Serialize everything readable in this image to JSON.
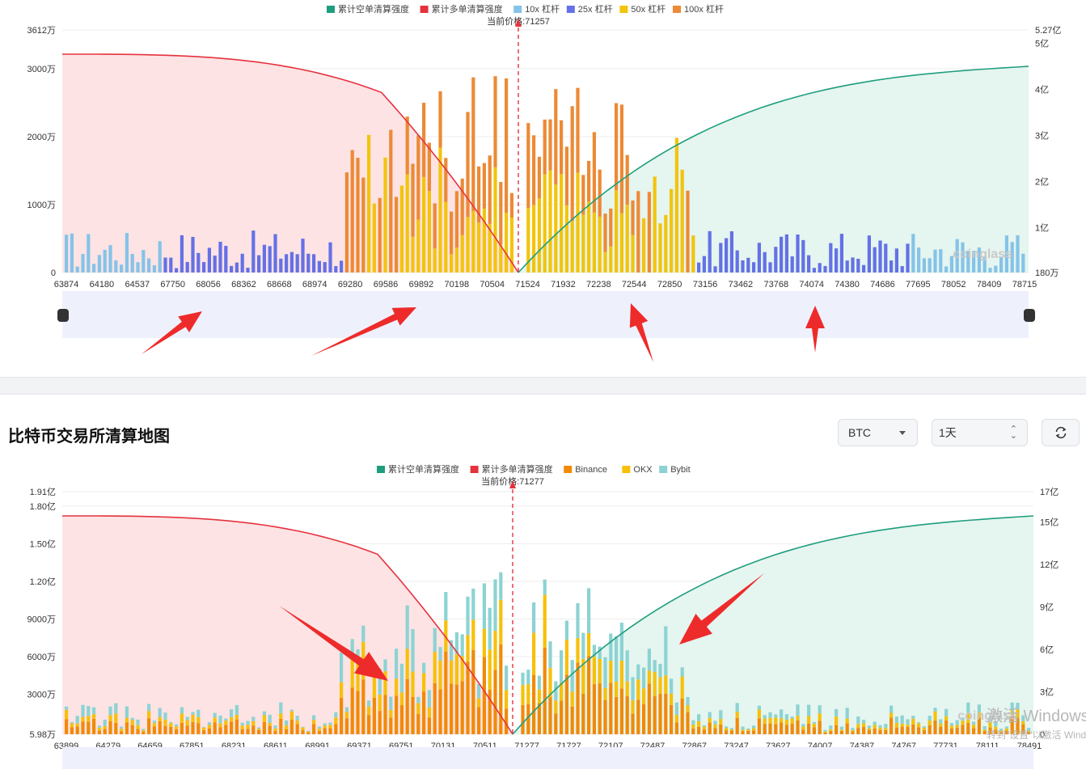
{
  "chart_data": [
    {
      "type": "bar",
      "legend": [
        "累计空单清算强度",
        "累计多单清算强度",
        "10x 杠杆",
        "25x 杠杆",
        "50x 杠杆",
        "100x 杠杆"
      ],
      "current_price_label": "当前价格:71257",
      "y_left_ticks": [
        "3612万",
        "3000万",
        "2000万",
        "1000万",
        "0"
      ],
      "y_right_ticks": [
        "5.27亿",
        "5亿",
        "4亿",
        "3亿",
        "2亿",
        "1亿",
        "180万"
      ],
      "x_ticks": [
        "63874",
        "64180",
        "64537",
        "67750",
        "68056",
        "68362",
        "68668",
        "68974",
        "69280",
        "69586",
        "69892",
        "70198",
        "70504",
        "71524",
        "71932",
        "72238",
        "72544",
        "72850",
        "73156",
        "73462",
        "73768",
        "74074",
        "74380",
        "74686",
        "77695",
        "78052",
        "78409",
        "78715"
      ],
      "ylim_left": [
        0,
        3612
      ],
      "ylim_right": [
        1.8,
        527
      ],
      "left_unit": "万",
      "right_unit": "百万",
      "current_price_index": 112,
      "series": [
        {
          "name": "100x 杠杆",
          "values": [
            0,
            0,
            0,
            0,
            0,
            0,
            0,
            0,
            0,
            0,
            0,
            0,
            0,
            0,
            0,
            0,
            0,
            0,
            0,
            0,
            0,
            0,
            0,
            0,
            0,
            0,
            0,
            0,
            0,
            0,
            0,
            0,
            0,
            0,
            0,
            0,
            0,
            0,
            0,
            0,
            0,
            0,
            0,
            0,
            0,
            0,
            0,
            0,
            0,
            0,
            0,
            0,
            0,
            0,
            0,
            0,
            0,
            0,
            0,
            0,
            0,
            0,
            0,
            0,
            0,
            0,
            0,
            0,
            0,
            100,
            0,
            0,
            0,
            0,
            0,
            0,
            0,
            0,
            0,
            0,
            200,
            0,
            0,
            0,
            500,
            0,
            0,
            0,
            300,
            0,
            0,
            0,
            400,
            0,
            0,
            0,
            900,
            1100,
            0,
            300,
            1900,
            400,
            2400,
            1400,
            3300,
            1700,
            1600,
            500,
            2900,
            1100,
            1800,
            1500,
            0,
            0,
            0,
            0,
            200,
            100,
            300,
            200,
            100,
            100,
            0,
            0,
            0,
            0,
            0,
            0,
            1300,
            1100,
            1700,
            700,
            0,
            2900,
            2000,
            1100,
            1800,
            400,
            1000,
            1300,
            400,
            1800,
            800,
            0,
            1300,
            1700,
            0,
            0,
            0,
            0,
            0,
            0,
            0,
            0,
            0,
            0,
            0,
            0,
            0,
            0,
            0,
            0,
            0,
            0,
            0,
            0,
            0,
            0,
            0,
            0,
            0,
            0,
            0,
            0,
            0,
            0,
            0,
            0,
            0,
            0,
            0,
            0,
            0,
            0,
            0,
            0,
            0,
            0,
            0,
            0,
            0,
            0,
            0,
            0,
            0,
            0,
            0,
            0,
            0,
            0,
            0,
            0,
            0,
            0,
            0,
            0
          ]
        },
        {
          "name": "50x 杠杆",
          "values": [
            0,
            0,
            0,
            0,
            0,
            0,
            0,
            0,
            0,
            0,
            0,
            0,
            0,
            0,
            0,
            0,
            0,
            0,
            0,
            0,
            0,
            0,
            0,
            0,
            0,
            0,
            0,
            0,
            0,
            0,
            0,
            0,
            0,
            0,
            0,
            0,
            0,
            0,
            0,
            0,
            0,
            0,
            0,
            0,
            0,
            0,
            0,
            0,
            0,
            0,
            0,
            0,
            0,
            0,
            0,
            0,
            0,
            0,
            0,
            0,
            0,
            0,
            0,
            0,
            0,
            0,
            0,
            0,
            0,
            0,
            0,
            0,
            0,
            0,
            0,
            0,
            0,
            0,
            0,
            0,
            0,
            0,
            0,
            0,
            0,
            0,
            0,
            0,
            0,
            0,
            0,
            0,
            0,
            0,
            0,
            0,
            0,
            0,
            0,
            0,
            0,
            0,
            0,
            0,
            0,
            0,
            0,
            0,
            0,
            0,
            0,
            0,
            0,
            0,
            0,
            0,
            0,
            0,
            0,
            0,
            0,
            0,
            0,
            0,
            0,
            0,
            0,
            0,
            0,
            0,
            0,
            0,
            0,
            0,
            0,
            0,
            0,
            0,
            0,
            0,
            0,
            0,
            0,
            0,
            0,
            0,
            0,
            0,
            0,
            0,
            0,
            0,
            0,
            0,
            0,
            0,
            0,
            0,
            0,
            0,
            0,
            0,
            0,
            0,
            0,
            0,
            0,
            0,
            0,
            0,
            0,
            0,
            0,
            0,
            0,
            0,
            0,
            0,
            0,
            0,
            0,
            0,
            0,
            0,
            0,
            0,
            0,
            0,
            0,
            0,
            0,
            0,
            0,
            0,
            0,
            0,
            0,
            0,
            0,
            0,
            0,
            0,
            0,
            0,
            0,
            0,
            0,
            0,
            0,
            0,
            0,
            0,
            0,
            0,
            0
          ]
        },
        {
          "name": "25x 杠杆",
          "values": [
            0,
            0,
            0,
            0,
            0,
            0,
            0,
            0,
            0,
            0,
            0,
            0,
            0,
            0,
            0,
            0,
            0,
            0,
            0,
            0,
            0,
            0,
            0,
            0,
            0,
            0,
            0,
            0,
            0,
            0,
            0,
            0,
            0,
            0,
            0,
            0,
            0,
            0,
            0,
            0,
            0,
            0,
            0,
            0,
            0,
            0,
            0,
            0,
            0,
            0,
            0,
            0,
            0,
            0,
            0,
            0,
            0,
            0,
            0,
            0,
            0,
            0,
            0,
            0,
            0,
            0,
            0,
            0,
            0,
            0,
            0,
            0,
            0,
            0,
            0,
            0,
            0,
            0,
            0,
            0,
            0,
            0,
            0,
            0,
            0,
            0,
            0,
            0,
            0,
            0,
            0,
            0,
            0,
            0,
            0,
            0,
            0,
            0,
            0,
            0,
            0,
            0,
            0,
            0,
            0,
            0,
            0,
            0,
            0,
            0,
            0,
            0,
            0,
            0,
            0,
            0,
            0,
            0,
            0,
            0,
            0,
            0,
            0,
            0,
            0,
            0,
            0,
            0,
            0,
            0,
            0,
            0,
            0,
            0,
            0,
            0,
            0,
            0,
            0,
            0,
            0,
            0,
            0,
            0,
            0,
            0,
            0,
            0,
            0,
            0,
            0,
            0,
            0,
            0,
            0,
            0,
            0,
            0,
            0,
            0,
            0,
            0,
            0,
            0,
            0,
            0,
            0,
            0,
            0,
            0,
            0,
            0,
            0,
            0,
            0,
            0,
            0,
            0,
            0,
            0,
            0,
            0,
            0,
            0,
            0,
            0,
            0,
            0,
            0,
            0,
            0,
            0,
            0,
            0,
            0,
            0,
            0,
            0,
            0,
            0,
            0,
            0,
            0,
            0,
            0,
            0,
            0,
            0,
            0,
            0,
            0,
            0,
            0,
            0,
            0
          ]
        },
        {
          "name": "10x 杠杆",
          "values": [
            0,
            0,
            0,
            0,
            0,
            0,
            0,
            0,
            0,
            0,
            0,
            0,
            0,
            0,
            0,
            0,
            0,
            0,
            0,
            0,
            0,
            0,
            0,
            0,
            0,
            0,
            0,
            0,
            0,
            0,
            0,
            0,
            0,
            0,
            0,
            0,
            0,
            0,
            0,
            0,
            0,
            0,
            0,
            0,
            0,
            0,
            0,
            0,
            0,
            0,
            0,
            0,
            0,
            0,
            0,
            0,
            0,
            0,
            0,
            0,
            0,
            0,
            0,
            0,
            0,
            0,
            0,
            0,
            0,
            0,
            0,
            0,
            0,
            0,
            0,
            0,
            0,
            0,
            0,
            0,
            0,
            0,
            0,
            0,
            0,
            0,
            0,
            0,
            0,
            0,
            0,
            0,
            0,
            0,
            0,
            0,
            0,
            0,
            0,
            0,
            0,
            0,
            0,
            0,
            0,
            0,
            0,
            0,
            0,
            0,
            0,
            0,
            0,
            0,
            0,
            0,
            0,
            0,
            0,
            0,
            0,
            0,
            0,
            0,
            0,
            0,
            0,
            0,
            0,
            0,
            0,
            0,
            0,
            0,
            0,
            0,
            0,
            0,
            0,
            0,
            0,
            0,
            0,
            0,
            0,
            0,
            0,
            0,
            0,
            0,
            0,
            0,
            0,
            0,
            0,
            0,
            0,
            0,
            0,
            0,
            0,
            0,
            0,
            0,
            0,
            0,
            0,
            0,
            0,
            0,
            0,
            0,
            0,
            0,
            0,
            0,
            0,
            0,
            0,
            0,
            0,
            0,
            0,
            0,
            0,
            0,
            0,
            0,
            0,
            0,
            0,
            0,
            0,
            0,
            0,
            0,
            0,
            0,
            0,
            0,
            0,
            0,
            0,
            0,
            0,
            0,
            0,
            0,
            0,
            0,
            0,
            0,
            0,
            0,
            0
          ]
        }
      ],
      "cumulative_long": [
        3350,
        3345,
        3340,
        3335,
        3330,
        3320,
        3310,
        3300,
        3290,
        3280,
        3270,
        3250,
        3230,
        3210,
        3190,
        3170,
        3150,
        3120,
        3090,
        3060,
        3030,
        3000,
        2980,
        2960,
        2940,
        2920,
        2900,
        2890,
        2870,
        2840,
        2800,
        2770,
        2740,
        2720,
        2700,
        2680,
        2650,
        2620,
        2590,
        2570,
        2550,
        2520,
        2500,
        2470,
        2440,
        2400,
        2360,
        2320,
        2280,
        2230,
        2180,
        2110,
        2040,
        1970,
        1900,
        1800,
        1680,
        1540,
        1380,
        1200,
        1000,
        800,
        600,
        400,
        200,
        60,
        0
      ],
      "cumulative_short": [
        0,
        60,
        120,
        180,
        200,
        220,
        240,
        400,
        600,
        800,
        1000,
        1200,
        1400,
        1600,
        1800,
        2000,
        2150,
        2250,
        2320,
        2400,
        2480,
        2560,
        2640,
        2720,
        2790,
        2860,
        2930,
        3000,
        3060,
        3120,
        3180,
        3240,
        3290,
        3330,
        3360,
        3390,
        3420,
        3450,
        3470,
        3490,
        3510,
        3530,
        3545,
        3560,
        3575,
        3590,
        3605,
        3620,
        3635,
        3650,
        3665,
        3680,
        3695,
        3710,
        3725,
        3740,
        3755,
        3770,
        3785,
        3800,
        3815,
        3830,
        3845,
        3860,
        3875,
        3890
      ]
    },
    {
      "type": "bar",
      "legend": [
        "累计空单清算强度",
        "累计多单清算强度",
        "Binance",
        "OKX",
        "Bybit"
      ],
      "current_price_label": "当前价格:71277",
      "y_left_ticks": [
        "1.91亿",
        "1.80亿",
        "1.50亿",
        "1.20亿",
        "9000万",
        "6000万",
        "3000万",
        "5.98万"
      ],
      "y_right_ticks": [
        "17亿",
        "15亿",
        "12亿",
        "9亿",
        "6亿",
        "3亿",
        "0"
      ],
      "x_ticks": [
        "63899",
        "64279",
        "64659",
        "67851",
        "68231",
        "68611",
        "68991",
        "69371",
        "69751",
        "70131",
        "70511",
        "71277",
        "71727",
        "72107",
        "72487",
        "72867",
        "73247",
        "73627",
        "74007",
        "74387",
        "74767",
        "77731",
        "78111",
        "78491"
      ],
      "ylim_left": [
        0.0598,
        19100
      ],
      "ylim_right": [
        0,
        1700
      ],
      "left_unit": "万",
      "right_unit": "百万"
    }
  ],
  "section_title": "比特币交易所清算地图",
  "controls": {
    "coin_value": "BTC",
    "time_value": "1天"
  },
  "watermark": "coinglass",
  "os_watermark": "激活 Windows",
  "os_watermark_sub": "转到\"设置\"以激活 Windows",
  "colors": {
    "short": "#1e9e7e",
    "long": "#e5323e",
    "lev10": "#85c3e8",
    "lev25": "#6471e6",
    "lev50": "#f2c40c",
    "lev100": "#ec8a36",
    "binance": "#f18a08",
    "okx": "#f7c00a",
    "bybit": "#8cd3d3",
    "short_fill": "#e5f5ef",
    "long_fill": "#fde3e4"
  }
}
